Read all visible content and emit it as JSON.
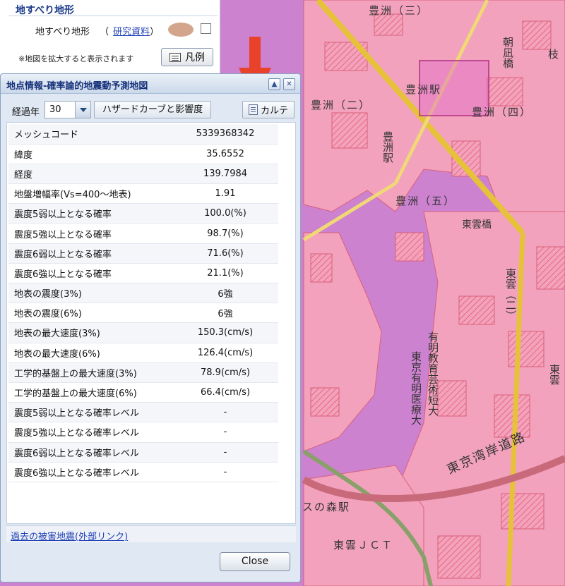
{
  "layer_panel": {
    "section_title": "地すべり地形",
    "layer_name": "地すべり地形",
    "research_link": "研究資料",
    "paren_open": "（",
    "paren_close": "）",
    "note": "※地図を拡大すると表示されます",
    "legend_label": "凡例"
  },
  "dialog": {
    "title": "地点情報-確率論的地震動予測地図",
    "elapsed_label": "経過年",
    "elapsed_value": "30",
    "hazard_button": "ハザードカーブと影響度",
    "karte_button": "カルテ",
    "rows": [
      {
        "key": "メッシュコード",
        "value": "5339368342"
      },
      {
        "key": "緯度",
        "value": "35.6552"
      },
      {
        "key": "経度",
        "value": "139.7984"
      },
      {
        "key": "地盤増幅率(Vs=400～地表)",
        "value": "1.91"
      },
      {
        "key": "震度5弱以上となる確率",
        "value": "100.0(%)"
      },
      {
        "key": "震度5強以上となる確率",
        "value": "98.7(%)"
      },
      {
        "key": "震度6弱以上となる確率",
        "value": "71.6(%)"
      },
      {
        "key": "震度6強以上となる確率",
        "value": "21.1(%)"
      },
      {
        "key": "地表の震度(3%)",
        "value": "6強"
      },
      {
        "key": "地表の震度(6%)",
        "value": "6強"
      },
      {
        "key": "地表の最大速度(3%)",
        "value": "150.3(cm/s)"
      },
      {
        "key": "地表の最大速度(6%)",
        "value": "126.4(cm/s)"
      },
      {
        "key": "工学的基盤上の最大速度(3%)",
        "value": "78.9(cm/s)"
      },
      {
        "key": "工学的基盤上の最大速度(6%)",
        "value": "66.4(cm/s)"
      },
      {
        "key": "震度5弱以上となる確率レベル",
        "value": "-"
      },
      {
        "key": "震度5強以上となる確率レベル",
        "value": "-"
      },
      {
        "key": "震度6弱以上となる確率レベル",
        "value": "-"
      },
      {
        "key": "震度6強以上となる確率レベル",
        "value": "-"
      }
    ],
    "past_quake_link": "過去の被害地震(外部リンク)",
    "close_label": "Close"
  },
  "map": {
    "labels": {
      "toyosu3": "豊洲（三）",
      "toyosu2": "豊洲（二）",
      "toyosu4": "豊洲（四）",
      "toyosu5": "豊洲（五）",
      "toyosu_station": "豊洲駅",
      "toyosu_station_v": "豊洲駅",
      "asakaze_bridge": "朝凪橋",
      "shinonome_bridge": "東雲橋",
      "shinonome2": "東雲（二）",
      "ariake_college": "有明教育芸術短大",
      "tokyo_ariake_hosp": "東京有明医療大",
      "shinonome_jct": "東雲ＪＣＴ",
      "wangan_road": "東京湾岸道路",
      "mori_station": "スの森駅",
      "kita": "枝",
      "higashi_kumo": "東雲"
    }
  },
  "colors": {
    "map_base": "#cf86cf",
    "map_land": "#f3a2bd",
    "road_main": "#e6c23b",
    "title_text": "#15307a",
    "arrow": "#e8432a",
    "link": "#1f3fb5"
  }
}
